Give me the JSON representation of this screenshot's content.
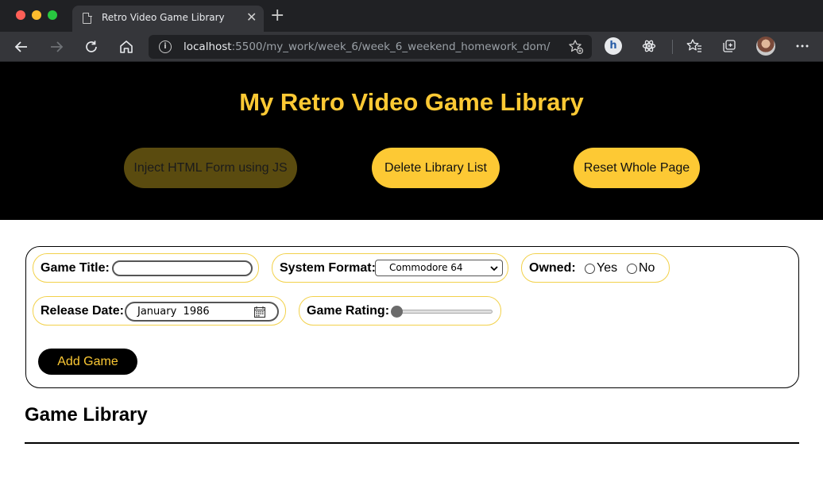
{
  "browser": {
    "tab_title": "Retro Video Game Library",
    "tab_close": "✕",
    "new_tab": "+",
    "url_host": "localhost",
    "url_path": ":5500/my_work/week_6/week_6_weekend_homework_dom/",
    "extension_letter": "h"
  },
  "header": {
    "title": "My Retro Video Game Library",
    "buttons": {
      "inject": "Inject HTML Form using JS",
      "delete": "Delete Library List",
      "reset": "Reset Whole Page"
    }
  },
  "form": {
    "game_title_label": "Game Title:",
    "game_title_value": "",
    "system_label": "System Format:",
    "system_selected": "Commodore 64",
    "owned_label": "Owned:",
    "owned_options": [
      "Yes",
      "No"
    ],
    "release_label": "Release Date:",
    "release_value": "January  1986",
    "rating_label": "Game Rating:",
    "rating_value": 0,
    "add_button": "Add Game"
  },
  "library": {
    "title": "Game Library"
  },
  "colors": {
    "accent_yellow": "#fcc934",
    "hero_bg": "#000000",
    "chrome_dark": "#202124"
  }
}
